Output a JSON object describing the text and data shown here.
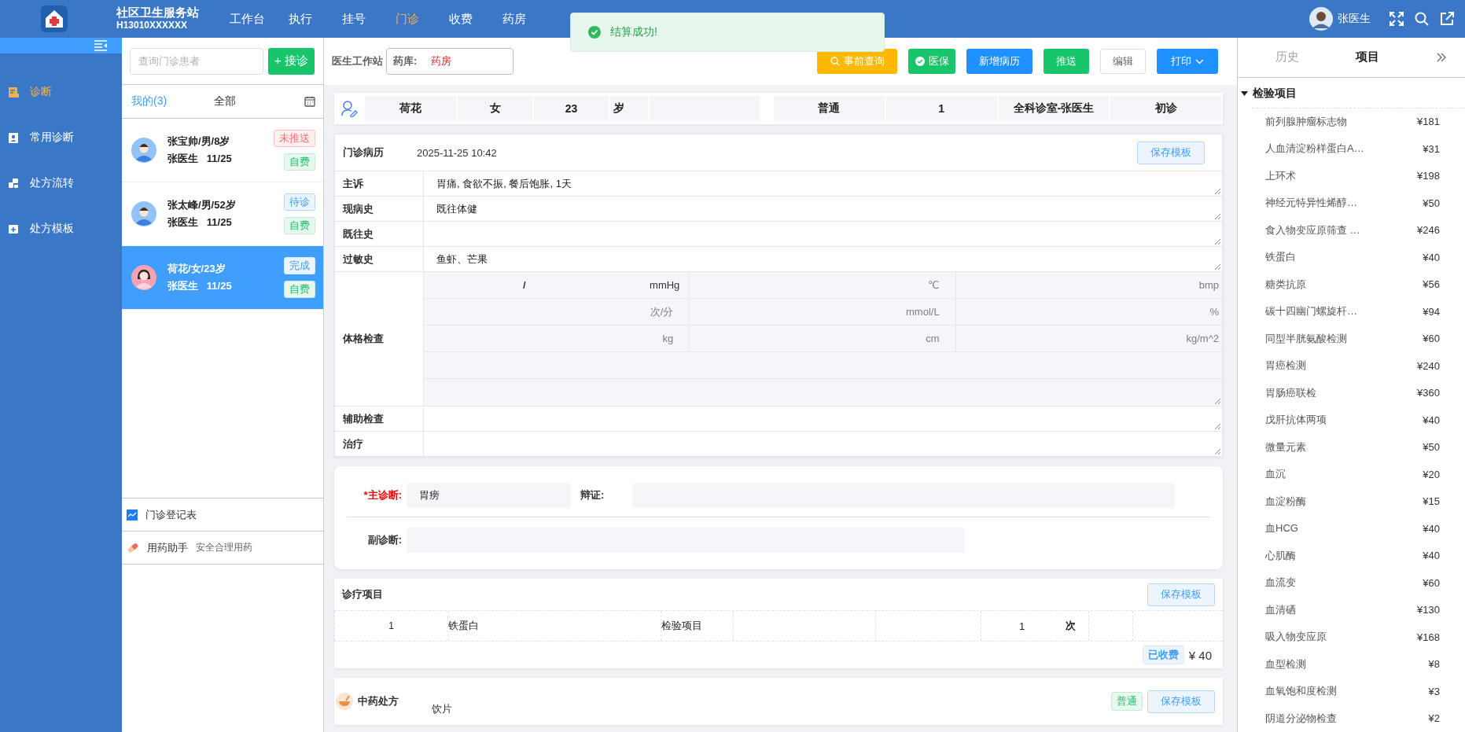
{
  "app": {
    "title": "社区卫生服务站",
    "code": "H13010XXXXXX"
  },
  "nav": [
    {
      "label": "工作台",
      "selected": false
    },
    {
      "label": "执行",
      "selected": false
    },
    {
      "label": "挂号",
      "selected": false
    },
    {
      "label": "门诊",
      "selected": true
    },
    {
      "label": "收费",
      "selected": false
    },
    {
      "label": "药房",
      "selected": false
    }
  ],
  "user": {
    "name": "张医生"
  },
  "toast": {
    "message": "结算成功!"
  },
  "sidebar": {
    "items": [
      {
        "label": "诊断",
        "selected": true
      },
      {
        "label": "常用诊断",
        "selected": false
      },
      {
        "label": "处方流转",
        "selected": false
      },
      {
        "label": "处方模板",
        "selected": false
      }
    ]
  },
  "patients": {
    "search_placeholder": "查询门诊患者",
    "add_button": "+ 接诊",
    "tabs": [
      {
        "label": "我的(3)",
        "selected": true
      },
      {
        "label": "全部",
        "selected": false
      }
    ],
    "list": [
      {
        "title": "张宝帅/男/8岁",
        "doctor": "张医生",
        "date": "11/25",
        "kind": "male",
        "status": {
          "label": "未推送",
          "kind": "unpushed"
        },
        "payment": "自费",
        "selected": false
      },
      {
        "title": "张太峰/男/52岁",
        "doctor": "张医生",
        "date": "11/25",
        "kind": "male",
        "status": {
          "label": "待诊",
          "kind": "waiting"
        },
        "payment": "自费",
        "selected": false
      },
      {
        "title": "荷花/女/23岁",
        "doctor": "张医生",
        "date": "11/25",
        "kind": "female",
        "status": {
          "label": "完成",
          "kind": "done"
        },
        "payment": "自费",
        "selected": true
      }
    ],
    "links": [
      {
        "label": "门诊登记表",
        "kind": "register"
      },
      {
        "label": "用药助手",
        "note": "安全合理用药",
        "kind": "assistant"
      }
    ]
  },
  "workstation": {
    "title": "医生工作站",
    "pharmacy": {
      "label": "药库:",
      "value": "药房"
    },
    "buttons": [
      {
        "label": "事前查询",
        "kind": "query"
      },
      {
        "label": "医保",
        "kind": "insurance"
      },
      {
        "label": "新增病历",
        "kind": "primary"
      },
      {
        "label": "推送",
        "kind": "success"
      },
      {
        "label": "编辑",
        "kind": "plain"
      },
      {
        "label": "打印",
        "kind": "print"
      }
    ]
  },
  "patient_bar": {
    "name": "荷花",
    "sex": "女",
    "age": "23",
    "age_unit": "岁",
    "visit_type": "普通",
    "number": "1",
    "department": "全科诊室-张医生",
    "visit": "初诊"
  },
  "record": {
    "title": "门诊病历",
    "datetime": "2025-11-25 10:42",
    "save_button": "保存模板",
    "fields_before": [
      {
        "label": "主诉",
        "value": "胃痛, 食欲不振, 餐后饱胀, 1天"
      },
      {
        "label": "现病史",
        "value": "既往体健"
      },
      {
        "label": "既往史"
      },
      {
        "label": "过敏史",
        "value": "鱼虾、芒果"
      }
    ],
    "exam": {
      "label": "体格检查",
      "bp_separator": "/",
      "rows": [
        [
          "mmHg",
          "℃",
          "bmp"
        ],
        [
          "次/分",
          "mmol/L",
          "%"
        ],
        [
          "kg",
          "cm",
          "kg/m^2"
        ]
      ]
    },
    "fields_after": [
      {
        "label": "辅助检查"
      },
      {
        "label": "治疗"
      }
    ]
  },
  "diagnosis": {
    "main_label": "*主诊断:",
    "main_value": "胃痨",
    "syndrome_label": "辩证:",
    "secondary_label": "副诊断:"
  },
  "treatment": {
    "title": "诊疗项目",
    "save_button": "保存模板",
    "rows": [
      {
        "index": "1",
        "name": "铁蛋白",
        "category": "检验项目",
        "quantity": "1",
        "unit": "次"
      }
    ],
    "paid": "已收费",
    "total": "¥ 40"
  },
  "herbal": {
    "title": "中药处方",
    "type": "饮片",
    "tag": "普通",
    "save_button": "保存模板"
  },
  "right_panel": {
    "tabs": [
      {
        "label": "历史",
        "selected": false
      },
      {
        "label": "项目",
        "selected": true
      }
    ],
    "group": {
      "label": "检验项目",
      "expanded": true,
      "items": [
        {
          "name": "前列腺肿瘤标志物",
          "price": "¥181"
        },
        {
          "name": "人血清淀粉样蛋白A…",
          "price": "¥31"
        },
        {
          "name": "上环术",
          "price": "¥198"
        },
        {
          "name": "神经元特异性烯醇…",
          "price": "¥50"
        },
        {
          "name": "食入物变应原筛查 …",
          "price": "¥246"
        },
        {
          "name": "铁蛋白",
          "price": "¥40"
        },
        {
          "name": "糖类抗原",
          "price": "¥56"
        },
        {
          "name": "碳十四幽门螺旋杆…",
          "price": "¥94"
        },
        {
          "name": "同型半胱氨酸检测",
          "price": "¥60"
        },
        {
          "name": "胃癌检测",
          "price": "¥240"
        },
        {
          "name": "胃肠癌联检",
          "price": "¥360"
        },
        {
          "name": "戊肝抗体两项",
          "price": "¥40"
        },
        {
          "name": "微量元素",
          "price": "¥50"
        },
        {
          "name": "血沉",
          "price": "¥20"
        },
        {
          "name": "血淀粉酶",
          "price": "¥15"
        },
        {
          "name": "血HCG",
          "price": "¥40"
        },
        {
          "name": "心肌酶",
          "price": "¥40"
        },
        {
          "name": "血流变",
          "price": "¥60"
        },
        {
          "name": "血清硒",
          "price": "¥130"
        },
        {
          "name": "吸入物变应原",
          "price": "¥168"
        },
        {
          "name": "血型检测",
          "price": "¥8"
        },
        {
          "name": "血氧饱和度检测",
          "price": "¥3"
        },
        {
          "name": "阴道分泌物检查",
          "price": "¥2"
        }
      ]
    }
  }
}
